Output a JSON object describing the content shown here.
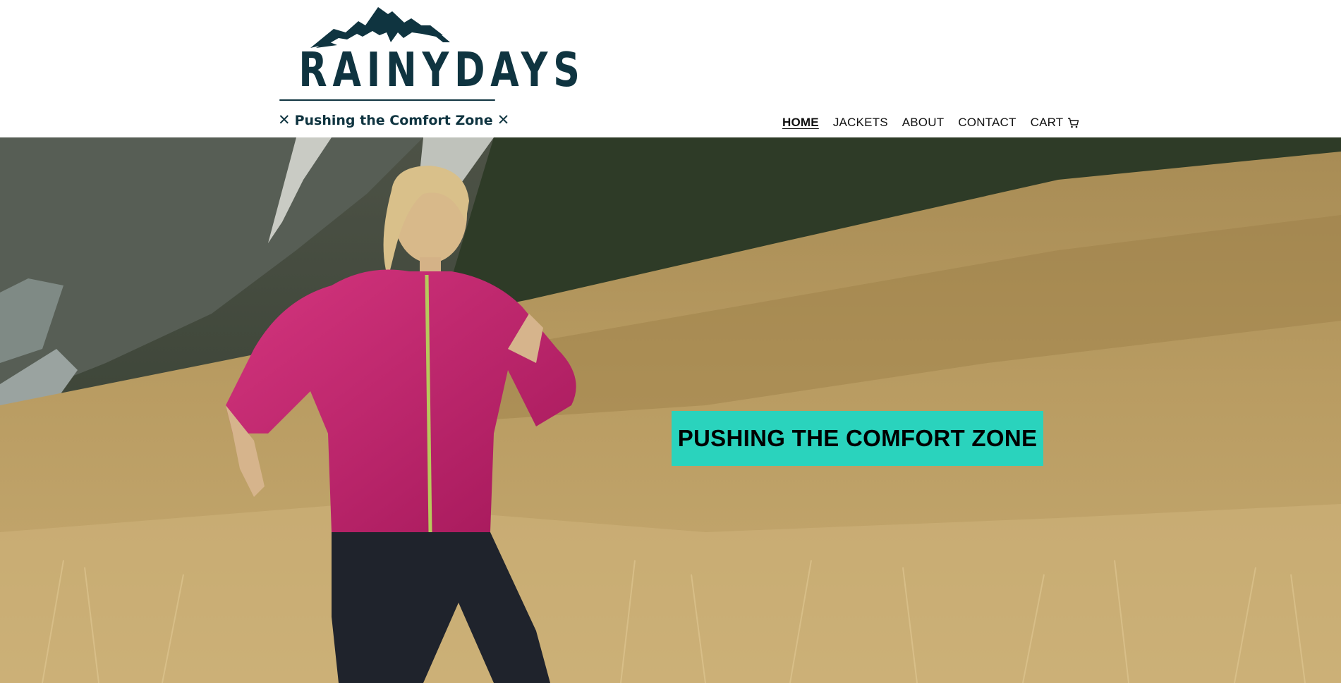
{
  "brand": {
    "name": "RAINYDAYS",
    "tagline": "Pushing the Comfort Zone",
    "color": "#0f3440"
  },
  "nav": {
    "items": [
      {
        "label": "HOME",
        "active": true
      },
      {
        "label": "JACKETS",
        "active": false
      },
      {
        "label": "ABOUT",
        "active": false
      },
      {
        "label": "CONTACT",
        "active": false
      },
      {
        "label": "CART",
        "active": false,
        "icon": "cart-icon"
      }
    ]
  },
  "hero": {
    "image": "woman-in-pink-jacket-running-on-mountain-meadow",
    "banner_text": "PUSHING THE COMFORT ZONE",
    "banner_color": "#2ad3bd"
  }
}
